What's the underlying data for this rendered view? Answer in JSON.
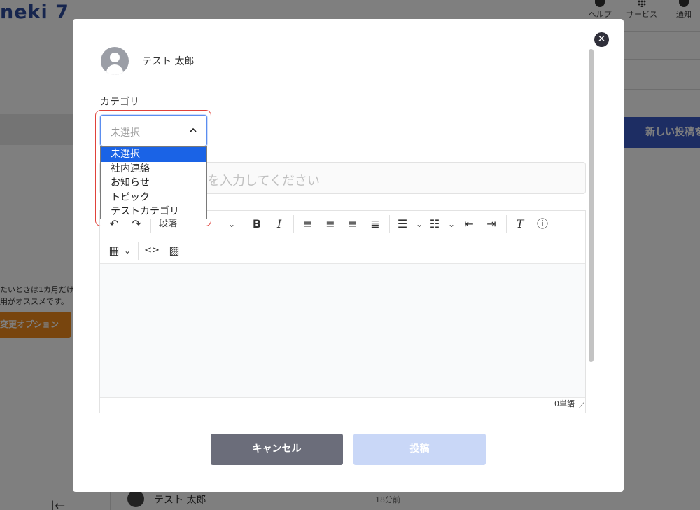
{
  "app": {
    "logo_text": "neki 7",
    "header": {
      "help": "ヘルプ",
      "services": "サービス",
      "notifications": "通知"
    },
    "new_post_button": "新しい投稿を",
    "promo_line1": "たいときは1カ月だけ",
    "promo_line2": "用がオススメです。",
    "promo_button": "変更オプション",
    "collapse_glyph": "|←",
    "feed_item": {
      "author": "テスト 太郎",
      "time": "18分前"
    }
  },
  "modal": {
    "user_name": "テスト 太郎",
    "category": {
      "label": "カテゴリ",
      "selected": "未選択",
      "options": [
        "未選択",
        "社内連絡",
        "お知らせ",
        "トピック",
        "テストカテゴリ"
      ]
    },
    "title_placeholder": "を入力してください",
    "toolbar": {
      "paragraph": "段落",
      "bold": "B",
      "italic": "I"
    },
    "word_count": "0単語",
    "cancel_label": "キャンセル",
    "post_label": "投稿"
  },
  "colors": {
    "overlay": "#000000",
    "primary": "#3a5bc7",
    "cancel": "#6b6d7a",
    "post_disabled": "#c9d7f7",
    "option_selected": "#1a63e6",
    "focus_ring": "#e0423a",
    "promo": "#f08a1c"
  }
}
